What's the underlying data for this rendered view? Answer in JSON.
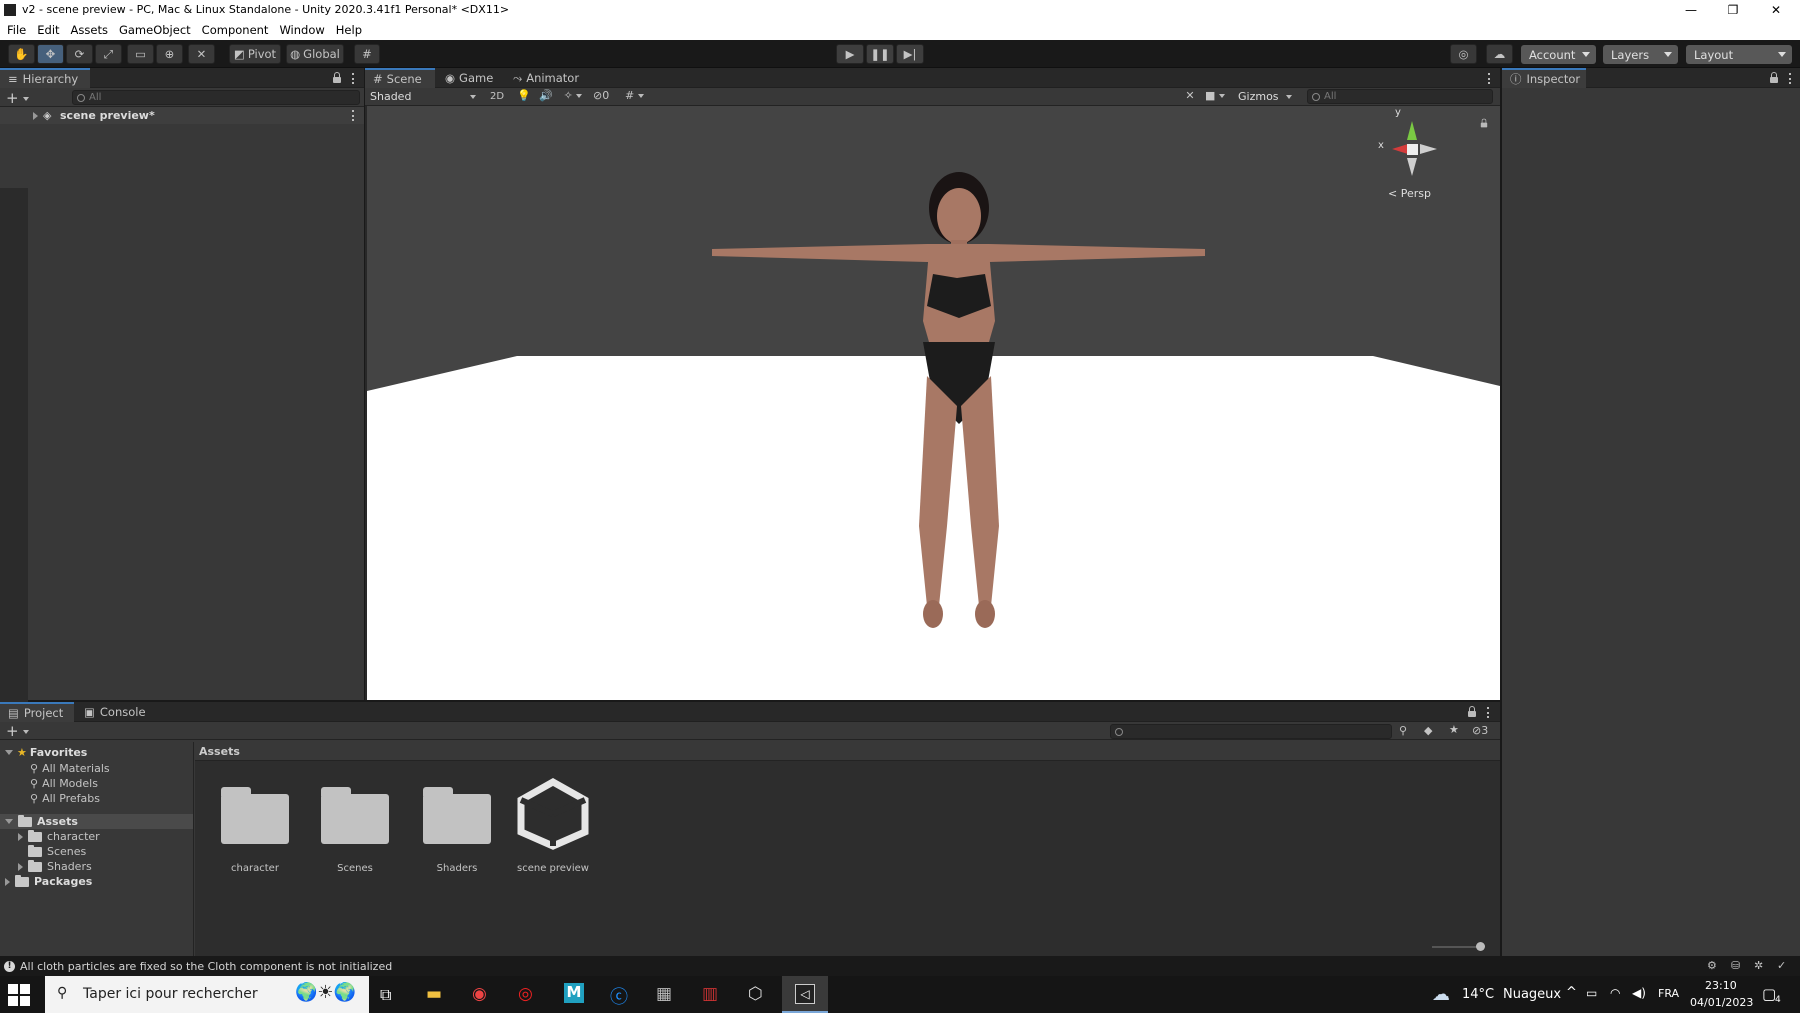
{
  "window": {
    "title": "v2 - scene preview - PC, Mac & Linux Standalone - Unity 2020.3.41f1 Personal* <DX11>",
    "minimize": "—",
    "restore": "❐",
    "close": "✕"
  },
  "menu": [
    "File",
    "Edit",
    "Assets",
    "GameObject",
    "Component",
    "Window",
    "Help"
  ],
  "toolbar": {
    "pivot_label": "Pivot",
    "global_label": "Global",
    "account_label": "Account",
    "layers_label": "Layers",
    "layout_label": "Layout"
  },
  "hierarchy": {
    "tab": "Hierarchy",
    "search_placeholder": "All",
    "scene_item": "scene preview*"
  },
  "scene_view": {
    "tabs": [
      "Scene",
      "Game",
      "Animator"
    ],
    "shading_mode": "Shaded",
    "mode_2d": "2D",
    "hidden_count": "0",
    "gizmos_label": "Gizmos",
    "search_placeholder": "All",
    "gizmo_y": "y",
    "gizmo_x": "x",
    "persp_label": "Persp"
  },
  "inspector": {
    "tab": "Inspector"
  },
  "project": {
    "tabs": [
      "Project",
      "Console"
    ],
    "hidden_count": "3",
    "favorites": {
      "label": "Favorites",
      "items": [
        "All Materials",
        "All Models",
        "All Prefabs"
      ]
    },
    "assets_tree": {
      "label": "Assets",
      "children": [
        "character",
        "Scenes",
        "Shaders"
      ]
    },
    "packages_label": "Packages",
    "breadcrumb": "Assets",
    "grid_items": [
      "character",
      "Scenes",
      "Shaders",
      "scene preview"
    ]
  },
  "status": {
    "message": "All cloth particles are fixed so the Cloth component is not initialized"
  },
  "taskbar": {
    "search_placeholder": "Taper ici pour rechercher",
    "weather_temp": "14°C",
    "weather_desc": "Nuageux",
    "lang": "FRA",
    "time": "23:10",
    "date": "04/01/2023",
    "notif_count": "4"
  },
  "colors": {
    "accent": "#3a79bb",
    "panel_bg": "#383838",
    "scene_sky": "#444444",
    "floor": "#ffffff",
    "skin": "#a87865",
    "bikini": "#1c1c1c"
  }
}
